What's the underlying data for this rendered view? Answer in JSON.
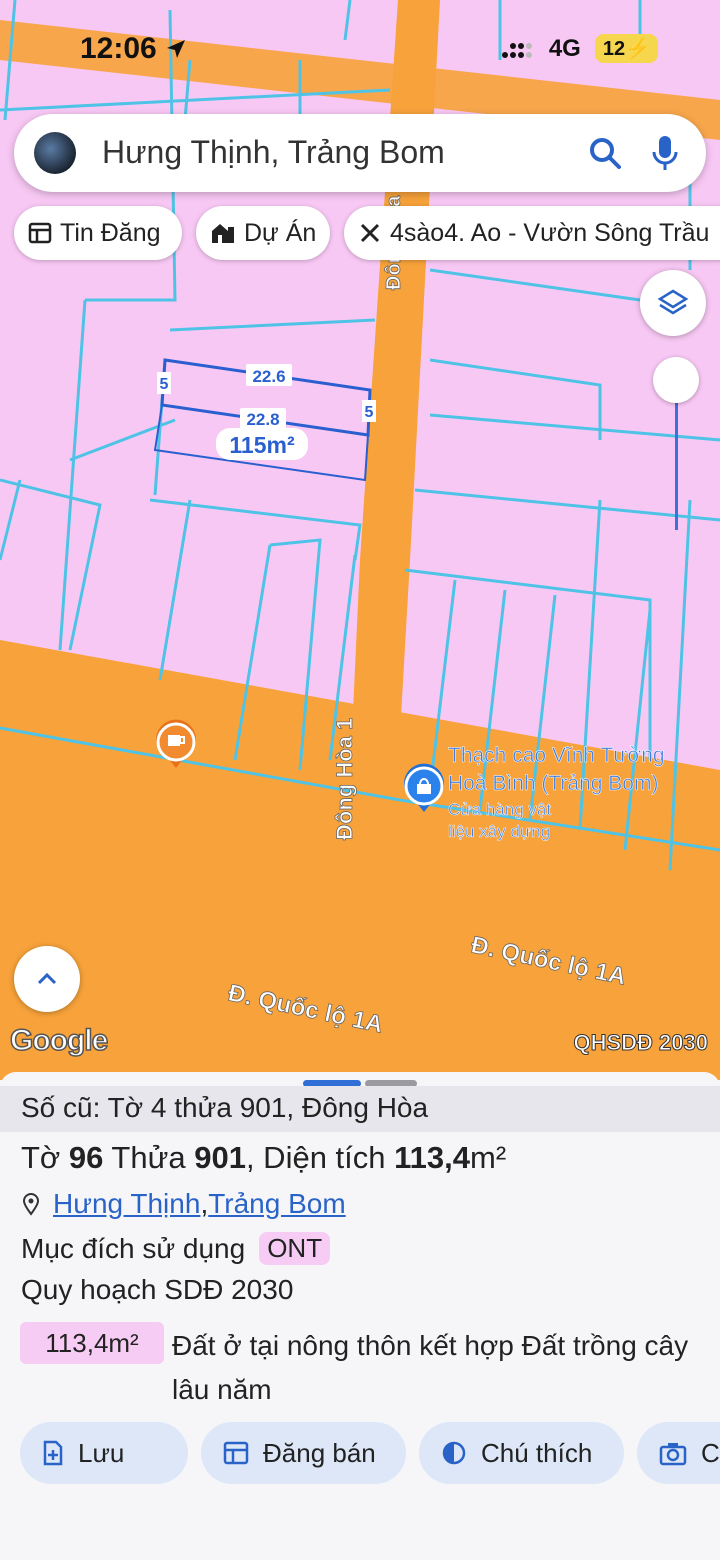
{
  "status": {
    "time": "12:06",
    "network": "4G",
    "battery": "12"
  },
  "search": {
    "query": "Hưng Thịnh, Trảng Bom"
  },
  "chips": [
    "Tin Đăng",
    "Dự Án",
    "4sào4. Ao - Vườn Sông Trầu"
  ],
  "map": {
    "parcel_top": "22.6",
    "parcel_bottom": "22.8",
    "parcel_side_left": "5",
    "parcel_side_right": "5",
    "parcel_area": "115m²",
    "road_vertical_top": "Đông Hòa",
    "road_vertical": "Đông Hòa 1",
    "poi_name": "Thạch cao Vĩnh Tường Hoà Bình (Trảng Bom)",
    "poi_name_line1": "Thạch cao Vĩnh Tường",
    "poi_name_line2": "Hoà Bình (Trảng Bom)",
    "poi_category_line1": "Cửa hàng vật",
    "poi_category_line2": "liệu xây dựng",
    "highway_1": "Đ. Quốc lộ 1A",
    "highway_2": "Đ. Quốc lộ 1A",
    "attribution": "Google",
    "layer_label": "QHSDĐ 2030",
    "colors": {
      "residential": "#f8c8f4",
      "road": "#f7a23a",
      "parcel_line": "#4fc3e6",
      "selected": "#2a5fd0"
    }
  },
  "sheet": {
    "old_number": "Số cũ: Tờ 4 thửa 901, Đông Hòa",
    "title_pre": "Tờ ",
    "sheet_no": "96",
    "title_mid": " Thửa ",
    "parcel_no": "901",
    "title_mid2": ", Diện tích ",
    "area": "113,4",
    "area_unit": "m²",
    "loc_ward": "Hưng Thịnh",
    "loc_sep": ", ",
    "loc_district": "Trảng Bom",
    "purpose_label": "Mục đích sử dụng",
    "purpose_code": "ONT",
    "plan_label": "Quy hoạch SDĐ 2030",
    "plan_area": "113,4m²",
    "plan_desc": "Đất ở tại nông thôn kết hợp Đất trồng cây lâu năm",
    "buttons": [
      "Lưu",
      "Đăng bán",
      "Chú thích",
      "C"
    ]
  }
}
